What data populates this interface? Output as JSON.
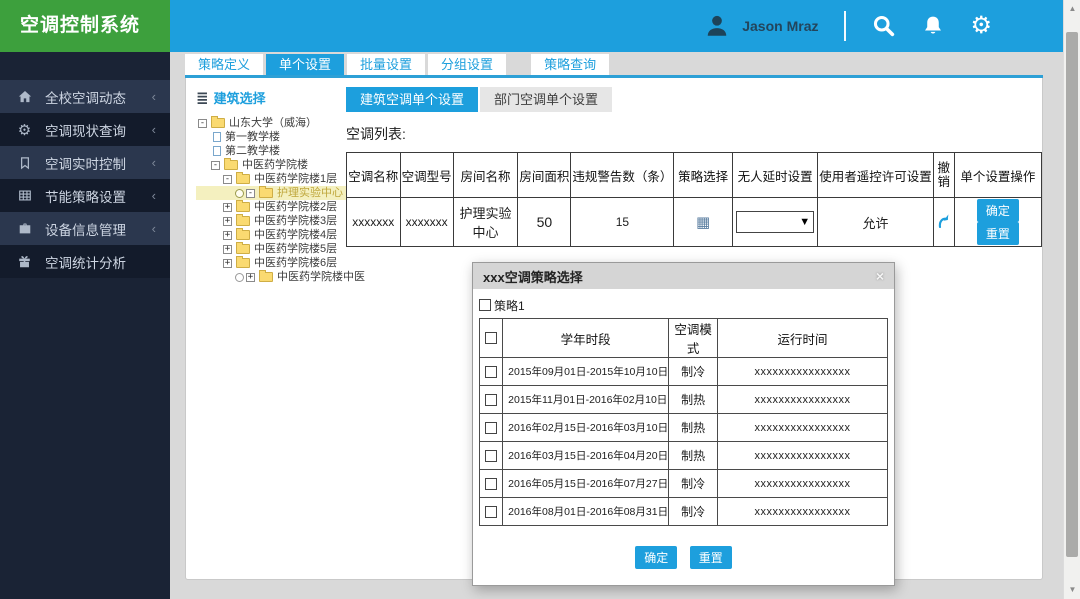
{
  "header": {
    "app_title": "空调控制系统",
    "user_name": "Jason Mraz"
  },
  "sidebar": {
    "items": [
      {
        "label": "全校空调动态",
        "icon": "home",
        "chevron": "‹"
      },
      {
        "label": "空调现状查询",
        "icon": "gears",
        "chevron": "‹"
      },
      {
        "label": "空调实时控制",
        "icon": "bookmark",
        "chevron": "‹"
      },
      {
        "label": "节能策略设置",
        "icon": "table",
        "chevron": "‹"
      },
      {
        "label": "设备信息管理",
        "icon": "briefcase",
        "chevron": "‹"
      },
      {
        "label": "空调统计分析",
        "icon": "gift",
        "chevron": ""
      }
    ]
  },
  "tabs": [
    {
      "label": "策略定义"
    },
    {
      "label": "单个设置"
    },
    {
      "label": "批量设置"
    },
    {
      "label": "分组设置"
    },
    {
      "label": "策略查询"
    }
  ],
  "tree": {
    "title": "建筑选择",
    "nodes": [
      {
        "label": "山东大学（威海）",
        "expander": "-"
      },
      {
        "label": "第一教学楼"
      },
      {
        "label": "第二教学楼"
      },
      {
        "label": "中医药学院楼",
        "expander": "-"
      },
      {
        "label": "中医药学院楼1层",
        "expander": "-"
      },
      {
        "label": "护理实验中心",
        "expander": "-",
        "selected": true
      },
      {
        "label": "中医药学院楼2层",
        "expander": "+"
      },
      {
        "label": "中医药学院楼3层",
        "expander": "+"
      },
      {
        "label": "中医药学院楼4层",
        "expander": "+"
      },
      {
        "label": "中医药学院楼5层",
        "expander": "+"
      },
      {
        "label": "中医药学院楼6层",
        "expander": "+"
      },
      {
        "label": "中医药学院楼中医",
        "expander": "+"
      }
    ]
  },
  "subtabs": [
    {
      "label": "建筑空调单个设置"
    },
    {
      "label": "部门空调单个设置"
    }
  ],
  "ac_list": {
    "label": "空调列表:",
    "columns": [
      "空调名称",
      "空调型号",
      "房间名称",
      "房间面积",
      "违规警告数（条）",
      "策略选择",
      "无人延时设置",
      "使用者遥控许可设置",
      "撤销",
      "单个设置操作"
    ],
    "row": {
      "name": "xxxxxxx",
      "model": "xxxxxxx",
      "room": "护理实验中心",
      "area": "50",
      "warnings": "15",
      "remote_permission": "允许",
      "confirm_label": "确定",
      "reset_label": "重置"
    }
  },
  "modal": {
    "title": "xxx空调策略选择",
    "close": "×",
    "policy_checkbox_label": "策略1",
    "table": {
      "columns": [
        "学年时段",
        "空调模式",
        "运行时间"
      ],
      "rows": [
        {
          "period": "2015年09月01日-2015年10月10日",
          "mode": "制冷",
          "runtime": "xxxxxxxxxxxxxxxx"
        },
        {
          "period": "2015年11月01日-2016年02月10日",
          "mode": "制热",
          "runtime": "xxxxxxxxxxxxxxxx"
        },
        {
          "period": "2016年02月15日-2016年03月10日",
          "mode": "制热",
          "runtime": "xxxxxxxxxxxxxxxx"
        },
        {
          "period": "2016年03月15日-2016年04月20日",
          "mode": "制热",
          "runtime": "xxxxxxxxxxxxxxxx"
        },
        {
          "period": "2016年05月15日-2016年07月27日",
          "mode": "制冷",
          "runtime": "xxxxxxxxxxxxxxxx"
        },
        {
          "period": "2016年08月01日-2016年08月31日",
          "mode": "制冷",
          "runtime": "xxxxxxxxxxxxxxxx"
        }
      ]
    },
    "confirm_label": "确定",
    "reset_label": "重置"
  },
  "colors": {
    "header_blue": "#1d9fdd",
    "brand_green": "#3da03d",
    "sidebar_dark": "#131b2b",
    "accent_blue": "#1d9fdd",
    "tree_selected_bg": "#f4f0bf"
  }
}
